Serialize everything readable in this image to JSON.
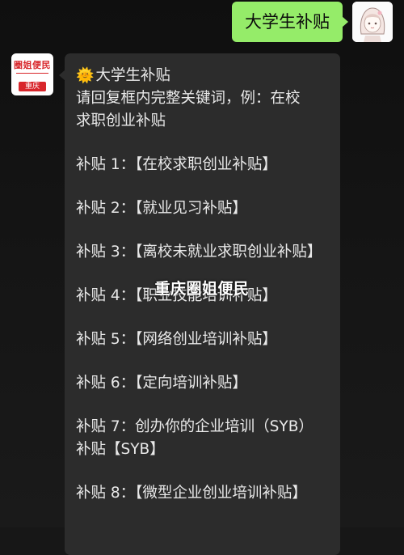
{
  "outgoing_message": {
    "text": "大学生补贴"
  },
  "incoming_message": {
    "sender_logo": {
      "name": "圈姐便民",
      "badge": "重庆"
    },
    "title_emoji": "🌞",
    "title": "大学生补贴",
    "instruction_line1": "请回复框内完整关键词，例：在校",
    "instruction_line2": "求职创业补贴",
    "items": [
      "补贴 1：【在校求职创业补贴】",
      "补贴 2：【就业见习补贴】",
      "补贴 3：【离校未就业求职创业补贴】",
      "补贴 4：【职业技能培训补贴】",
      "补贴 5：【网络创业培训补贴】",
      "补贴 6：【定向培训补贴】",
      "补贴 7：创办你的企业培训（SYB）补贴【SYB】",
      "补贴 8：【微型企业创业培训补贴】"
    ]
  },
  "watermark": "重庆圈姐便民",
  "colors": {
    "outgoing_bubble": "#95ec69",
    "incoming_bubble": "#2c2c2c",
    "logo_red": "#d8262b"
  }
}
